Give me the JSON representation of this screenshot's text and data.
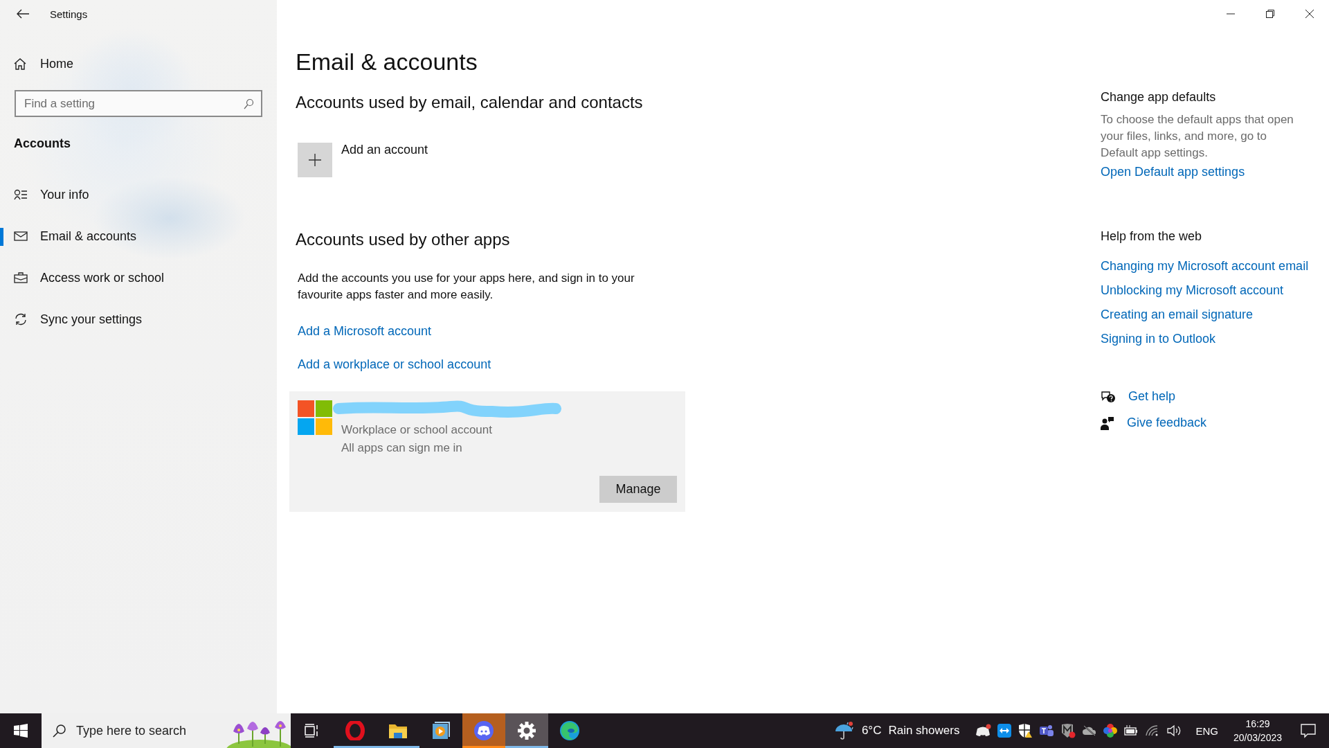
{
  "window": {
    "title": "Settings"
  },
  "sidebar": {
    "home": "Home",
    "search": {
      "placeholder": "Find a setting"
    },
    "section": "Accounts",
    "items": [
      {
        "kind": "info",
        "label": "Your info",
        "selected": false
      },
      {
        "kind": "mail",
        "label": "Email & accounts",
        "selected": true
      },
      {
        "kind": "work",
        "label": "Access work or school",
        "selected": false
      },
      {
        "kind": "sync",
        "label": "Sync your settings",
        "selected": false
      }
    ]
  },
  "page": {
    "title": "Email & accounts",
    "email_section": {
      "heading": "Accounts used by email, calendar and contacts",
      "add_account": "Add an account"
    },
    "other_apps": {
      "heading": "Accounts used by other apps",
      "description": "Add the accounts you use for your apps here, and sign in to your favourite apps faster and more easily.",
      "links": [
        "Add a Microsoft account",
        "Add a workplace or school account"
      ],
      "account": {
        "type": "Workplace or school account",
        "access": "All apps can sign me in",
        "button": "Manage"
      }
    }
  },
  "side_panel": {
    "defaults": {
      "heading": "Change app defaults",
      "text": "To choose the default apps that open your files, links, and more, go to Default app settings.",
      "link": "Open Default app settings"
    },
    "help": {
      "heading": "Help from the web",
      "links": [
        "Changing my Microsoft account email",
        "Unblocking my Microsoft account",
        "Creating an email signature",
        "Signing in to Outlook"
      ]
    },
    "actions": [
      {
        "kind": "help",
        "label": "Get help"
      },
      {
        "kind": "feedback",
        "label": "Give feedback"
      }
    ]
  },
  "taskbar": {
    "search": {
      "placeholder": "Type here to search"
    },
    "apps": [
      {
        "kind": "task-view",
        "running": false,
        "attention": false,
        "selected": false
      },
      {
        "kind": "opera",
        "running": true,
        "attention": false,
        "selected": false
      },
      {
        "kind": "explorer",
        "running": true,
        "attention": false,
        "selected": false
      },
      {
        "kind": "media",
        "running": false,
        "attention": false,
        "selected": false
      },
      {
        "kind": "discord",
        "running": true,
        "attention": true,
        "selected": false
      },
      {
        "kind": "settings",
        "running": true,
        "attention": false,
        "selected": true
      },
      {
        "kind": "edge",
        "running": false,
        "attention": false,
        "selected": false
      }
    ],
    "weather": {
      "temperature": "6°C",
      "condition": "Rain showers"
    },
    "tray_icons": [
      {
        "kind": "discord"
      },
      {
        "kind": "remote"
      },
      {
        "kind": "security"
      },
      {
        "kind": "teams"
      },
      {
        "kind": "antivirus"
      },
      {
        "kind": "cloud"
      },
      {
        "kind": "color"
      },
      {
        "kind": "battery"
      },
      {
        "kind": "wifi"
      },
      {
        "kind": "volume"
      }
    ],
    "language": "ENG",
    "time": "16:29",
    "date": "20/03/2023"
  }
}
